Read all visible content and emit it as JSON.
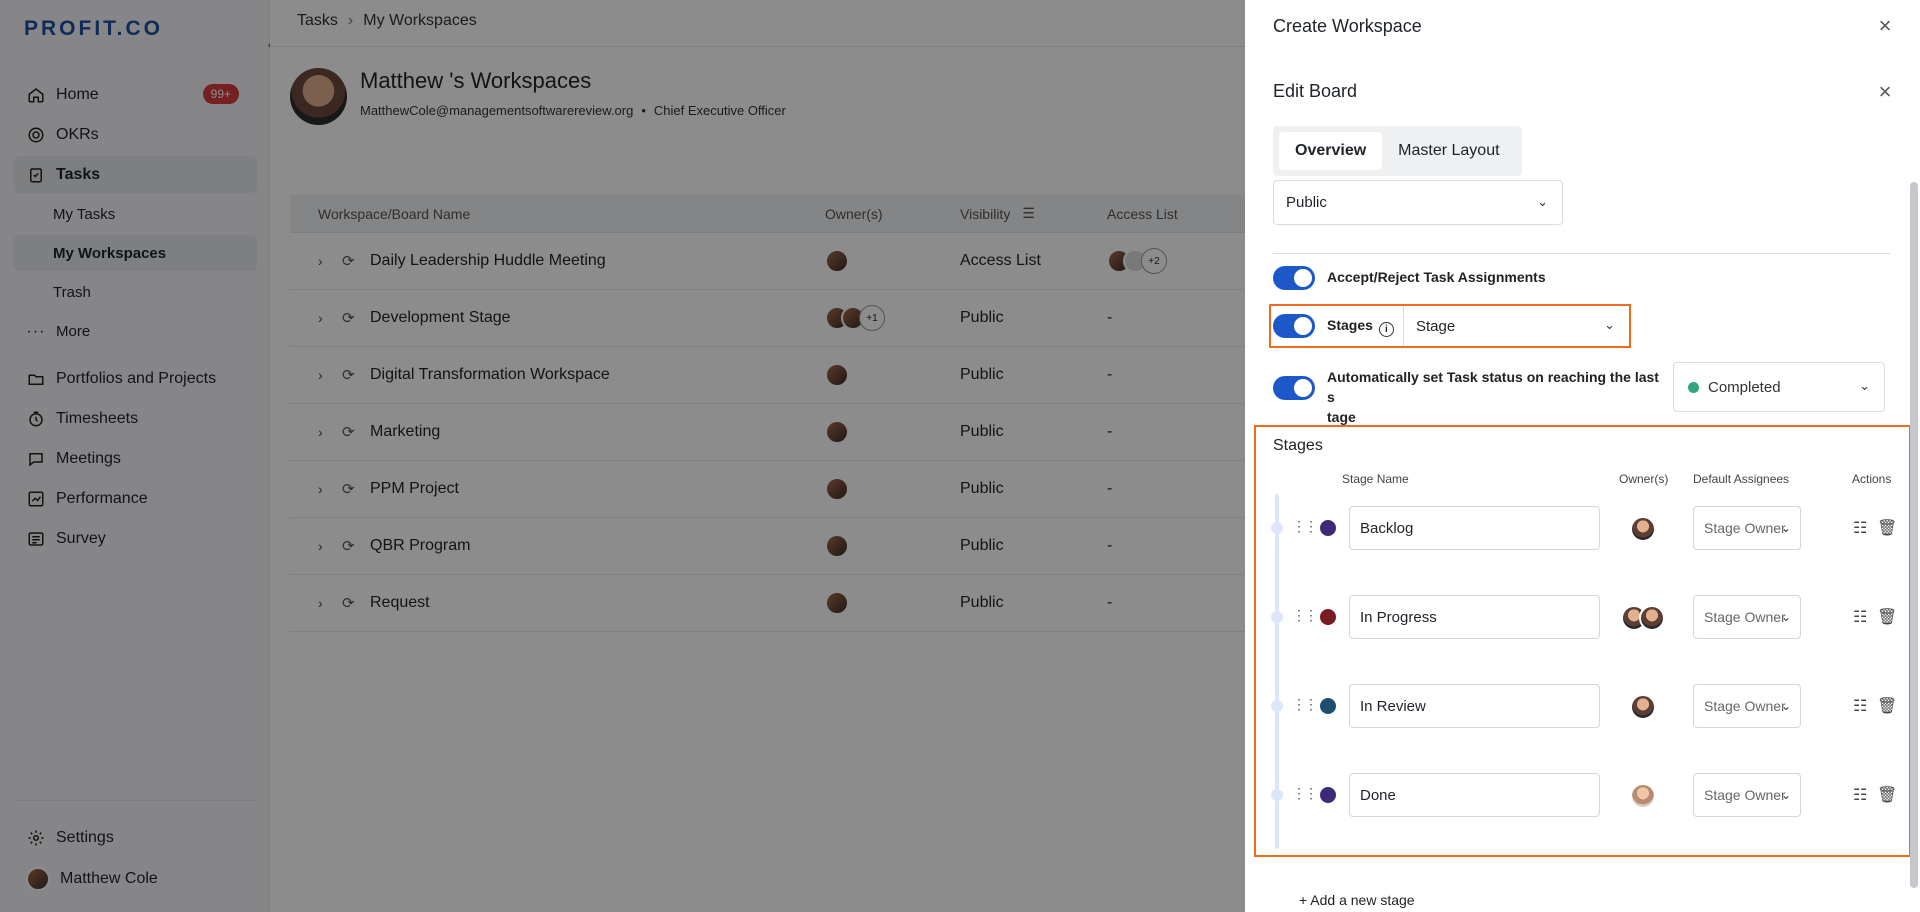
{
  "app": {
    "logo": "PROFIT.CO"
  },
  "sidebar": {
    "items": [
      {
        "label": "Home",
        "badge": "99+",
        "icon": "home-icon"
      },
      {
        "label": "OKRs",
        "icon": "target-icon"
      },
      {
        "label": "Tasks",
        "icon": "clipboard-icon"
      },
      {
        "label": "My Tasks"
      },
      {
        "label": "My Workspaces"
      },
      {
        "label": "Trash"
      },
      {
        "label": "More",
        "icon": "more-icon"
      },
      {
        "label": "Portfolios and Projects",
        "icon": "folder-icon"
      },
      {
        "label": "Timesheets",
        "icon": "clock-icon"
      },
      {
        "label": "Meetings",
        "icon": "chat-icon"
      },
      {
        "label": "Performance",
        "icon": "chart-icon"
      },
      {
        "label": "Survey",
        "icon": "survey-icon"
      }
    ],
    "settings": "Settings",
    "user": "Matthew Cole"
  },
  "main": {
    "breadcrumb": [
      "Tasks",
      "My Workspaces"
    ],
    "profile": {
      "name": "Matthew 's Workspaces",
      "email": "MatthewCole@managementsoftwarereview.org",
      "role": "Chief Executive Officer"
    },
    "table": {
      "headers": [
        "Workspace/Board Name",
        "Owner(s)",
        "Visibility",
        "Access List"
      ],
      "rows": [
        {
          "name": "Daily Leadership Huddle Meeting",
          "visibility": "Access List",
          "access": "+2",
          "owner_extra": ""
        },
        {
          "name": "Development Stage",
          "visibility": "Public",
          "access": "-",
          "owner_extra": "+1"
        },
        {
          "name": "Digital Transformation Workspace",
          "visibility": "Public",
          "access": "-",
          "owner_extra": ""
        },
        {
          "name": "Marketing",
          "visibility": "Public",
          "access": "-",
          "owner_extra": ""
        },
        {
          "name": "PPM Project",
          "visibility": "Public",
          "access": "-",
          "owner_extra": ""
        },
        {
          "name": "QBR Program",
          "visibility": "Public",
          "access": "-",
          "owner_extra": ""
        },
        {
          "name": "Request",
          "visibility": "Public",
          "access": "-",
          "owner_extra": ""
        }
      ]
    }
  },
  "panel": {
    "title": "Create Workspace",
    "edit_title": "Edit Board",
    "tabs": [
      "Overview",
      "Master Layout"
    ],
    "visibility_value": "Public",
    "accept_reject_label": "Accept/Reject Task Assignments",
    "stages_label": "Stages",
    "stages_select": "Stage",
    "auto_status_label": "Automatically set Task status on reaching the last s tage",
    "auto_status_label_line1": "Automatically set Task status on reaching the last s",
    "auto_status_label_line2": "tage",
    "auto_status_value": "Completed",
    "stages_section_title": "Stages",
    "columns": [
      "Stage Name",
      "Owner(s)",
      "Default Assignees",
      "Actions"
    ],
    "stages": [
      {
        "name": "Backlog",
        "color": "#3f2a7a",
        "assignee": "Stage Owner"
      },
      {
        "name": "In Progress",
        "color": "#7a1a22",
        "assignee": "Stage Owner"
      },
      {
        "name": "In Review",
        "color": "#1f4e6e",
        "assignee": "Stage Owner"
      },
      {
        "name": "Done",
        "color": "#3f2a7a",
        "assignee": "Stage Owner"
      }
    ],
    "add_stage": "+ Add a new stage"
  },
  "colors": {
    "accent": "#1d58c9",
    "highlight": "#f06a1f",
    "badge": "#d63d3d",
    "completed": "#2ea67a"
  }
}
